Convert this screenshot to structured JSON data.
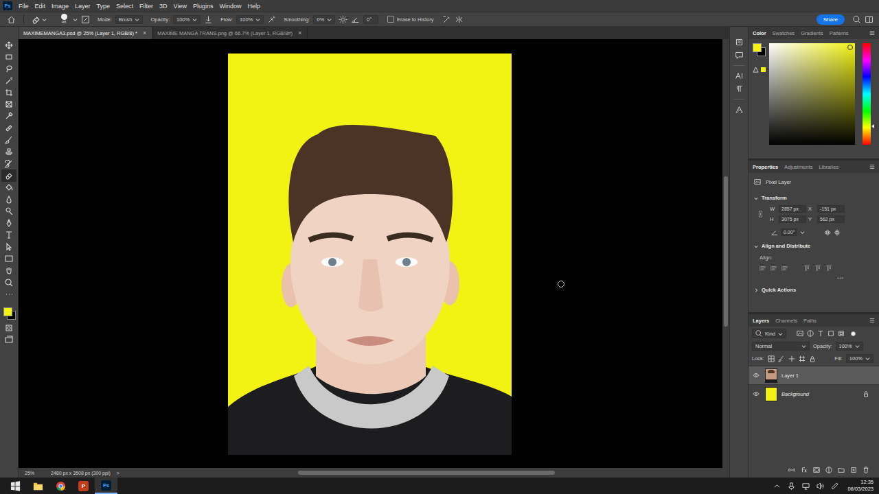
{
  "menubar": {
    "logo": "Ps",
    "items": [
      "File",
      "Edit",
      "Image",
      "Layer",
      "Type",
      "Select",
      "Filter",
      "3D",
      "View",
      "Plugins",
      "Window",
      "Help"
    ]
  },
  "options": {
    "brush_size": "48",
    "mode_label": "Mode:",
    "mode": "Brush",
    "opacity_label": "Opacity:",
    "opacity": "100%",
    "flow_label": "Flow:",
    "flow": "100%",
    "smoothing_label": "Smoothing:",
    "smoothing": "0%",
    "angle": "0°",
    "erase_to_history": {
      "label": "Erase to History",
      "checked": false
    },
    "share": "Share"
  },
  "tabs": [
    {
      "label": "MAXIMEMANGA3.psd @ 25% (Layer 1, RGB/8) *",
      "selected": true,
      "close": "×"
    },
    {
      "label": "MAXIME MANGA TRANS.png @ 66.7% (Layer 1, RGB/8#)",
      "selected": false,
      "close": "×"
    }
  ],
  "tools": [
    {
      "selected": false
    },
    {
      "selected": false
    },
    {
      "selected": false
    },
    {
      "selected": false
    },
    {
      "selected": false
    },
    {
      "selected": false
    },
    {
      "selected": false
    },
    {
      "selected": false
    },
    {
      "selected": false
    },
    {
      "selected": false
    },
    {
      "selected": false
    },
    {
      "selected": true
    },
    {
      "selected": false
    },
    {
      "selected": false
    },
    {
      "selected": false
    },
    {
      "selected": false
    },
    {
      "selected": false
    },
    {
      "selected": false
    },
    {
      "selected": false
    },
    {
      "selected": false
    },
    {
      "selected": false
    },
    {
      "selected": false
    },
    {
      "selected": false
    },
    {
      "selected": false
    }
  ],
  "status": {
    "zoom": "25%",
    "size": "2480 px x 3508 px (300 ppi)",
    "arrow": ">"
  },
  "scroll": {
    "horizontal": {
      "offset": 0.29,
      "size": 0.43
    },
    "vertical": {
      "offset": 0.32,
      "size": 0.35
    }
  },
  "color_panel": {
    "tabs": [
      {
        "label": "Color",
        "selected": true
      },
      {
        "label": "Swatches",
        "selected": false
      },
      {
        "label": "Gradients",
        "selected": false
      },
      {
        "label": "Patterns",
        "selected": false
      }
    ],
    "foreground": "#f2f213",
    "background": "#000000",
    "field_color": "#f2f213",
    "saturation": 0.94,
    "brightness": 0.96,
    "hue_level": 0.82
  },
  "properties": {
    "tabs": [
      {
        "label": "Properties",
        "selected": true
      },
      {
        "label": "Adjustments",
        "selected": false
      },
      {
        "label": "Libraries",
        "selected": false
      }
    ],
    "layer_type": "Pixel Layer",
    "transform": {
      "title": "Transform",
      "expanded": true,
      "w_label": "W",
      "w": "2857 px",
      "x_label": "X",
      "x": "-151 px",
      "h_label": "H",
      "h": "3075 px",
      "y_label": "Y",
      "y": "562 px",
      "angle": "0.00°"
    },
    "align": {
      "title": "Align and Distribute",
      "expanded": true,
      "label": "Align:",
      "more": "•••"
    },
    "quick_actions": {
      "title": "Quick Actions",
      "expanded": false
    }
  },
  "layers_panel": {
    "tabs": [
      {
        "label": "Layers",
        "selected": true
      },
      {
        "label": "Channels",
        "selected": false
      },
      {
        "label": "Paths",
        "selected": false
      }
    ],
    "filter": "Kind",
    "filter_on": true,
    "blend": "Normal",
    "opacity_label": "Opacity:",
    "opacity": "100%",
    "lock_label": "Lock:",
    "fill_label": "Fill:",
    "fill": "100%",
    "layers": [
      {
        "name": "Layer 1",
        "selected": true,
        "visible": true,
        "locked": false,
        "kind": "photo",
        "color": "#c49a84"
      },
      {
        "name": "Background",
        "selected": false,
        "visible": true,
        "locked": true,
        "kind": "fill",
        "color": "#f2f213"
      }
    ]
  },
  "taskbar": {
    "apps": [
      {
        "kind": "windows",
        "selected": false
      },
      {
        "kind": "explorer",
        "selected": false
      },
      {
        "kind": "chrome",
        "selected": false
      },
      {
        "kind": "powerpoint",
        "label": "P",
        "selected": false
      },
      {
        "kind": "photoshop",
        "label": "Ps",
        "selected": true
      }
    ],
    "clock": {
      "time": "12:35",
      "date": "06/03/2023"
    }
  }
}
